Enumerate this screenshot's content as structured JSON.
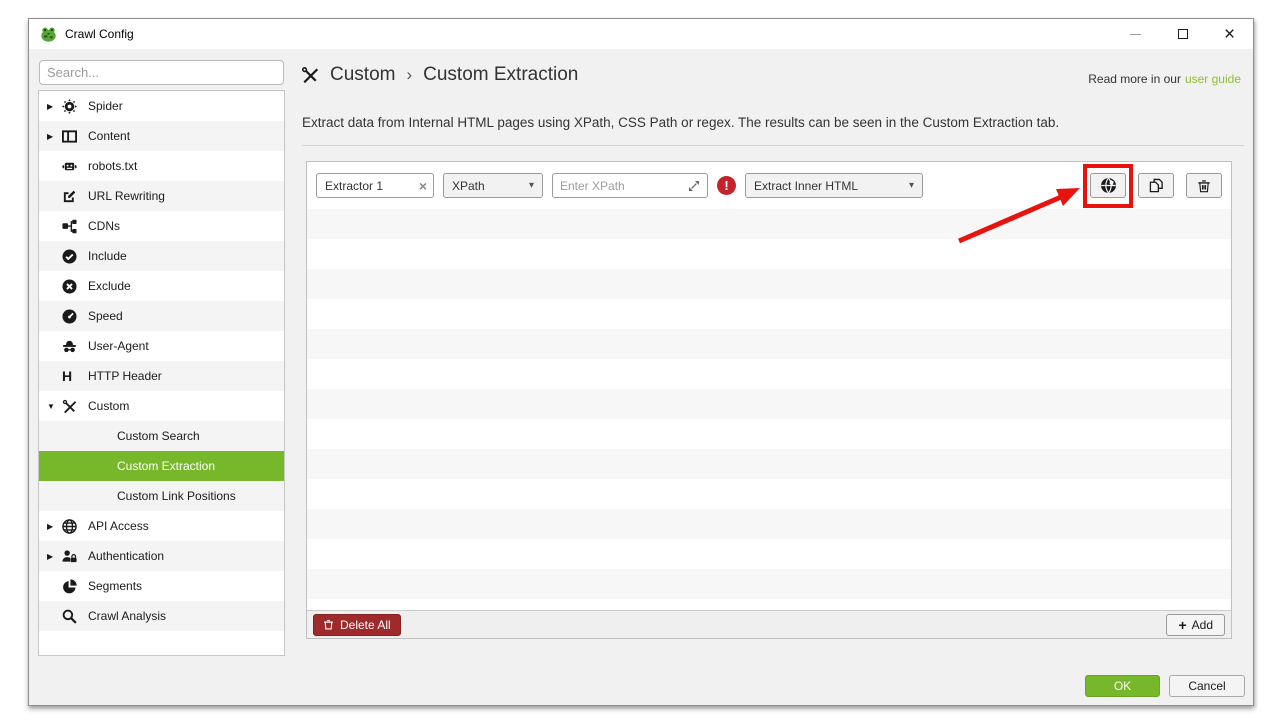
{
  "titlebar": {
    "title": "Crawl Config"
  },
  "sidebar": {
    "search_placeholder": "Search...",
    "items": [
      {
        "label": "Spider",
        "icon": "gear",
        "expandable": true
      },
      {
        "label": "Content",
        "icon": "columns",
        "expandable": true
      },
      {
        "label": "robots.txt",
        "icon": "robot"
      },
      {
        "label": "URL Rewriting",
        "icon": "edit-pencil"
      },
      {
        "label": "CDNs",
        "icon": "network-nodes"
      },
      {
        "label": "Include",
        "icon": "check-circle"
      },
      {
        "label": "Exclude",
        "icon": "x-circle"
      },
      {
        "label": "Speed",
        "icon": "speedometer"
      },
      {
        "label": "User-Agent",
        "icon": "incognito"
      },
      {
        "label": "HTTP Header",
        "icon": "letter-h"
      },
      {
        "label": "Custom",
        "icon": "tools",
        "expanded": true
      },
      {
        "label": "Custom Search",
        "child": true
      },
      {
        "label": "Custom Extraction",
        "child": true,
        "selected": true
      },
      {
        "label": "Custom Link Positions",
        "child": true
      },
      {
        "label": "API Access",
        "icon": "globe",
        "expandable": true
      },
      {
        "label": "Authentication",
        "icon": "user-lock",
        "expandable": true
      },
      {
        "label": "Segments",
        "icon": "pie-chart"
      },
      {
        "label": "Crawl Analysis",
        "icon": "magnifier"
      }
    ]
  },
  "header": {
    "breadcrumb_parent": "Custom",
    "breadcrumb_separator": "›",
    "breadcrumb_current": "Custom Extraction",
    "read_more_text": "Read more in our",
    "read_more_link": "user guide"
  },
  "description": "Extract data from Internal HTML pages using XPath, CSS Path or regex. The results can be seen in the Custom Extraction tab.",
  "extractor": {
    "name_value": "Extractor 1",
    "type_selected": "XPath",
    "xpath_placeholder": "Enter XPath",
    "output_selected": "Extract Inner HTML"
  },
  "panel_footer": {
    "delete_all_label": "Delete All",
    "add_label": "Add"
  },
  "dialog_footer": {
    "ok_label": "OK",
    "cancel_label": "Cancel"
  },
  "icons": {
    "expand_collapsed": "▶",
    "expand_expanded": "▼",
    "dropdown_arrow": "▾",
    "clear": "×",
    "error_mark": "!",
    "add_plus": "+",
    "http_header_glyph": "H",
    "close_glyph": "×"
  },
  "colors": {
    "accent_green": "#76b82a",
    "link_green": "#8bc034",
    "highlight_red": "#e8120e",
    "error_red": "#c4232b",
    "delete_button_red": "#9e2a2b"
  }
}
